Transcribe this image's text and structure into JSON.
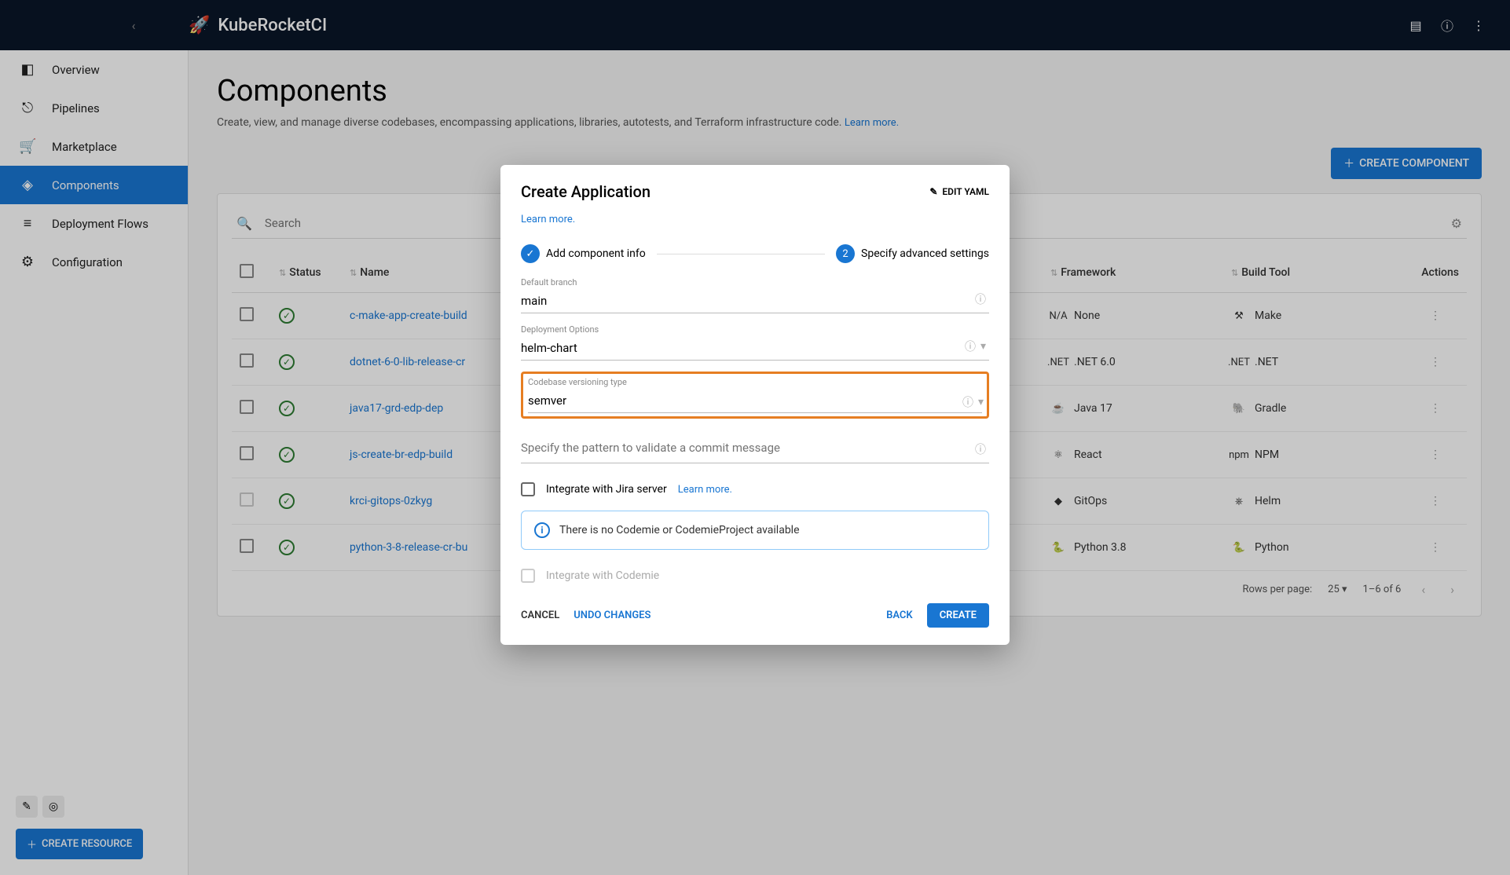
{
  "app": {
    "name": "KubeRocketCI"
  },
  "topbar": {
    "chat_icon": "chat",
    "info_icon": "info",
    "menu_icon": "more"
  },
  "sidebar": {
    "items": [
      {
        "label": "Overview",
        "icon": "◧"
      },
      {
        "label": "Pipelines",
        "icon": "⎋"
      },
      {
        "label": "Marketplace",
        "icon": "🛒"
      },
      {
        "label": "Components",
        "icon": "◈"
      },
      {
        "label": "Deployment Flows",
        "icon": "≡"
      },
      {
        "label": "Configuration",
        "icon": "⚙"
      }
    ],
    "create_resource": "CREATE RESOURCE"
  },
  "page": {
    "title": "Components",
    "description": "Create, view, and manage diverse codebases, encompassing applications, libraries, autotests, and Terraform infrastructure code.",
    "learn_more": "Learn more.",
    "create_component": "CREATE COMPONENT",
    "search_placeholder": "Search"
  },
  "table": {
    "headers": {
      "status": "Status",
      "name": "Name",
      "framework": "Framework",
      "build_tool": "Build Tool",
      "actions": "Actions"
    },
    "rows": [
      {
        "name": "c-make-app-create-build",
        "framework": "None",
        "fw_icon": "N/A",
        "build_tool": "Make",
        "bt_icon": "⚒"
      },
      {
        "name": "dotnet-6-0-lib-release-cr",
        "framework": ".NET 6.0",
        "fw_icon": ".NET",
        "build_tool": ".NET",
        "bt_icon": ".NET"
      },
      {
        "name": "java17-grd-edp-dep",
        "framework": "Java 17",
        "fw_icon": "☕",
        "build_tool": "Gradle",
        "bt_icon": "🐘"
      },
      {
        "name": "js-create-br-edp-build",
        "framework": "React",
        "fw_icon": "⚛",
        "build_tool": "NPM",
        "bt_icon": "npm"
      },
      {
        "name": "krci-gitops-0zkyg",
        "framework": "GitOps",
        "fw_icon": "◆",
        "build_tool": "Helm",
        "bt_icon": "⎈",
        "dim": true
      },
      {
        "name": "python-3-8-release-cr-bu",
        "framework": "Python 3.8",
        "fw_icon": "🐍",
        "build_tool": "Python",
        "bt_icon": "🐍"
      }
    ],
    "pager": {
      "rows_per_page_label": "Rows per page:",
      "rows_per_page": "25",
      "range": "1–6 of 6"
    }
  },
  "dialog": {
    "title": "Create Application",
    "edit_yaml": "EDIT YAML",
    "learn_more": "Learn more.",
    "step1": "Add component info",
    "step2": "Specify advanced settings",
    "step2_num": "2",
    "default_branch_label": "Default branch",
    "default_branch": "main",
    "deployment_options_label": "Deployment Options",
    "deployment_options": "helm-chart",
    "versioning_label": "Codebase versioning type",
    "versioning": "semver",
    "commit_pattern_placeholder": "Specify the pattern to validate a commit message",
    "jira_label": "Integrate with Jira server",
    "jira_learn_more": "Learn more.",
    "codemie_banner": "There is no Codemie or CodemieProject available",
    "codemie_label": "Integrate with Codemie",
    "cancel": "CANCEL",
    "undo": "UNDO CHANGES",
    "back": "BACK",
    "create": "CREATE"
  }
}
